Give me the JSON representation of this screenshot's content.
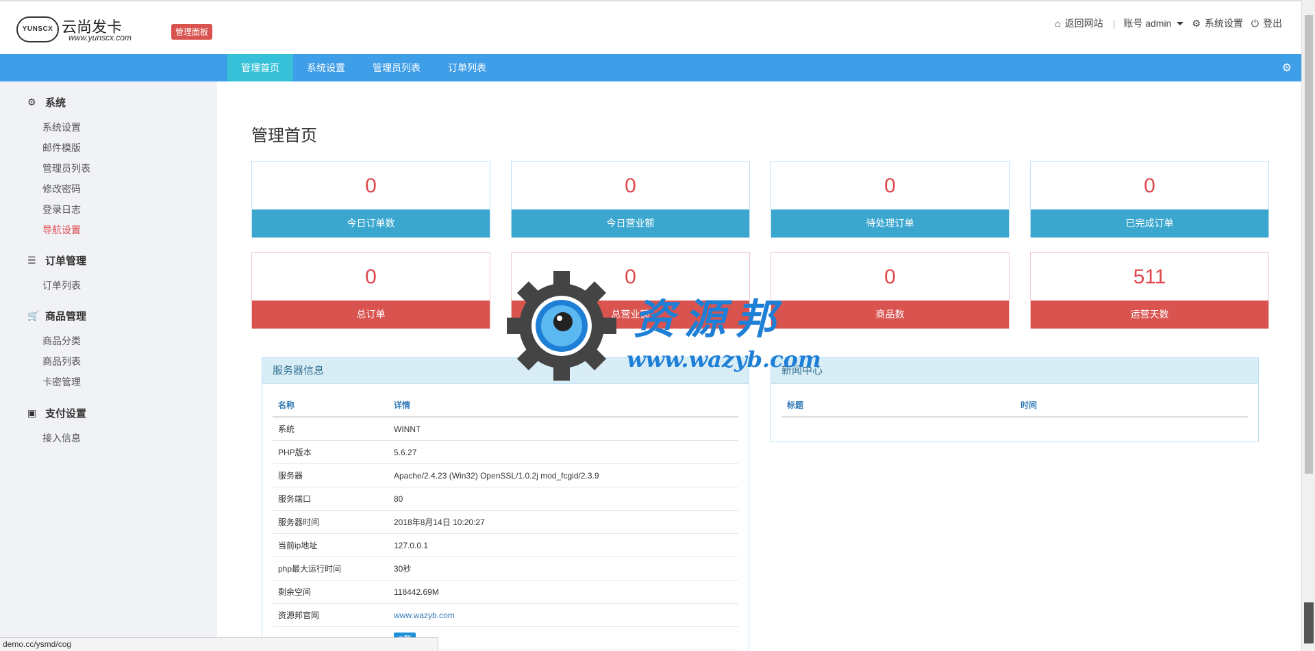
{
  "header": {
    "logo_cloud": "YUNSCX",
    "logo_title": "云尚发卡",
    "logo_url": "www.yunscx.com",
    "badge": "管理面板",
    "back_site": "返回网站",
    "account": "账号 admin",
    "settings": "系统设置",
    "logout": "登出"
  },
  "nav": {
    "tabs": [
      "管理首页",
      "系统设置",
      "管理员列表",
      "订单列表"
    ]
  },
  "sidebar": {
    "groups": [
      {
        "label": "系统",
        "icon": "gear-icon",
        "items": [
          "系统设置",
          "邮件模版",
          "管理员列表",
          "修改密码",
          "登录日志",
          "导航设置"
        ]
      },
      {
        "label": "订单管理",
        "icon": "list-icon",
        "items": [
          "订单列表"
        ]
      },
      {
        "label": "商品管理",
        "icon": "cart-icon",
        "items": [
          "商品分类",
          "商品列表",
          "卡密管理"
        ]
      },
      {
        "label": "支付设置",
        "icon": "credit-card-icon",
        "items": [
          "接入信息"
        ]
      }
    ],
    "active_item": "导航设置"
  },
  "main": {
    "title": "管理首页",
    "stats": [
      {
        "value": "0",
        "label": "今日订单数"
      },
      {
        "value": "0",
        "label": "今日营业额"
      },
      {
        "value": "0",
        "label": "待处理订单"
      },
      {
        "value": "0",
        "label": "已完成订单"
      },
      {
        "value": "0",
        "label": "总订单"
      },
      {
        "value": "0",
        "label": "总营业额"
      },
      {
        "value": "0",
        "label": "商品数"
      },
      {
        "value": "511",
        "label": "运营天数"
      }
    ],
    "server": {
      "title": "服务器信息",
      "col_name": "名称",
      "col_detail": "详情",
      "rows": [
        {
          "name": "系统",
          "detail": "WINNT"
        },
        {
          "name": "PHP版本",
          "detail": "5.6.27"
        },
        {
          "name": "服务器",
          "detail": "Apache/2.4.23 (Win32) OpenSSL/1.0.2j mod_fcgid/2.3.9"
        },
        {
          "name": "服务端口",
          "detail": "80"
        },
        {
          "name": "服务器时间",
          "detail": "2018年8月14日 10:20:27"
        },
        {
          "name": "当前ip地址",
          "detail": "127.0.0.1"
        },
        {
          "name": "php最大运行时间",
          "detail": "30秒"
        },
        {
          "name": "剩余空间",
          "detail": "118442.69M"
        },
        {
          "name": "资源邦官网",
          "detail": "www.wazyb.com"
        },
        {
          "name": "",
          "detail": "Q群"
        }
      ]
    },
    "news": {
      "title": "新闻中心",
      "col_title": "标题",
      "col_time": "时间"
    }
  },
  "watermark": {
    "text": "资源邦",
    "url": "www.wazyb.com"
  },
  "status_bar": {
    "url": "demo.cc/ysmd/cog"
  },
  "colors": {
    "nav": "#3f9ee8",
    "nav_active": "#36c1d9",
    "stat_blue": "#3ba7cf",
    "stat_red": "#d9534f",
    "number": "#e0484e"
  }
}
